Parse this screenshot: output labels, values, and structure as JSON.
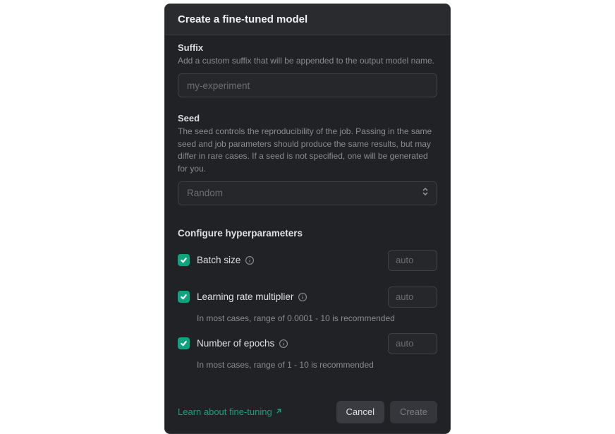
{
  "header": {
    "title": "Create a fine-tuned model"
  },
  "suffix": {
    "label": "Suffix",
    "desc": "Add a custom suffix that will be appended to the output model name.",
    "placeholder": "my-experiment",
    "value": ""
  },
  "seed": {
    "label": "Seed",
    "desc": "The seed controls the reproducibility of the job. Passing in the same seed and job parameters should produce the same results, but may differ in rare cases. If a seed is not specified, one will be generated for you.",
    "selected": "Random"
  },
  "hp_section": {
    "title": "Configure hyperparameters"
  },
  "batch": {
    "label": "Batch size",
    "placeholder": "auto",
    "checked": true,
    "value": ""
  },
  "lr": {
    "label": "Learning rate multiplier",
    "placeholder": "auto",
    "checked": true,
    "value": "",
    "note": "In most cases, range of 0.0001 - 10 is recommended"
  },
  "epochs": {
    "label": "Number of epochs",
    "placeholder": "auto",
    "checked": true,
    "value": "",
    "note": "In most cases, range of 1 - 10 is recommended"
  },
  "footer": {
    "learn_link": "Learn about fine-tuning",
    "cancel": "Cancel",
    "create": "Create"
  }
}
